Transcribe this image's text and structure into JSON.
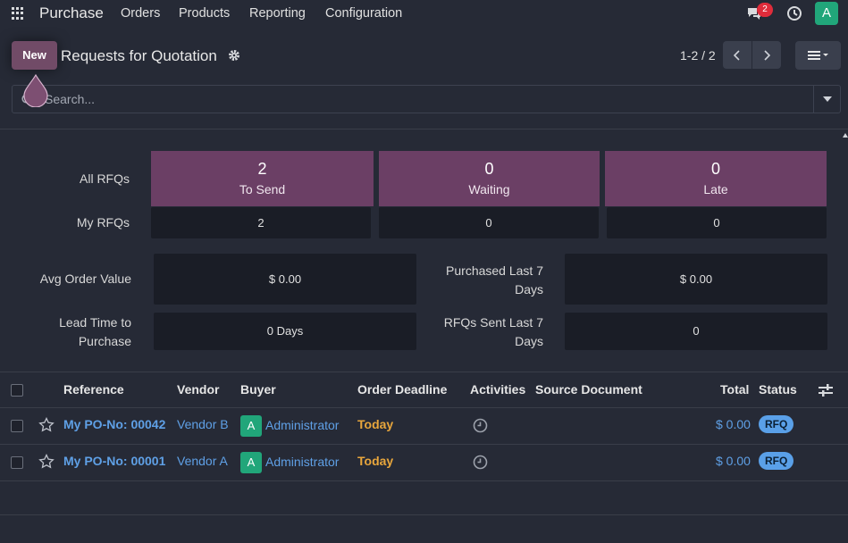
{
  "navbar": {
    "brand": "Purchase",
    "menu": [
      "Orders",
      "Products",
      "Reporting",
      "Configuration"
    ],
    "chat_badge": "2",
    "avatar_letter": "A"
  },
  "control": {
    "new_label": "New",
    "title": "Requests for Quotation",
    "pager": "1-2 / 2",
    "search_placeholder": "Search..."
  },
  "dashboard": {
    "row1_label": "All RFQs",
    "row2_label": "My RFQs",
    "tiles": [
      {
        "num": "2",
        "label": "To Send"
      },
      {
        "num": "0",
        "label": "Waiting"
      },
      {
        "num": "0",
        "label": "Late"
      }
    ],
    "my_values": [
      "2",
      "0",
      "0"
    ],
    "metrics": [
      {
        "label_l1": "Avg Order Value",
        "label_l2": "",
        "value": "$ 0.00"
      },
      {
        "label_l1": "Purchased Last 7",
        "label_l2": "Days",
        "value": "$ 0.00"
      },
      {
        "label_l1": "Lead Time to",
        "label_l2": "Purchase",
        "value": "0 Days"
      },
      {
        "label_l1": "RFQs Sent Last 7",
        "label_l2": "Days",
        "value": "0"
      }
    ]
  },
  "table": {
    "columns": [
      "Reference",
      "Vendor",
      "Buyer",
      "Order Deadline",
      "Activities",
      "Source Document",
      "Total",
      "Status"
    ],
    "rows": [
      {
        "reference": "My PO-No: 00042",
        "vendor": "Vendor B",
        "buyer_initial": "A",
        "buyer": "Administrator",
        "deadline": "Today",
        "source": "",
        "total": "$ 0.00",
        "status": "RFQ"
      },
      {
        "reference": "My PO-No: 00001",
        "vendor": "Vendor A",
        "buyer_initial": "A",
        "buyer": "Administrator",
        "deadline": "Today",
        "source": "",
        "total": "$ 0.00",
        "status": "RFQ"
      }
    ]
  },
  "colors": {
    "accent": "#714b67",
    "tile": "#6b3f65",
    "link": "#5fa0e6",
    "deadline": "#e8a63c",
    "avatar": "#21a67a"
  },
  "icons": [
    "apps-grid-icon",
    "chat-icon",
    "clock-icon",
    "gear-icon",
    "chevron-left-icon",
    "chevron-right-icon",
    "list-view-icon",
    "search-icon",
    "caret-down-icon",
    "star-icon",
    "activity-clock-icon",
    "column-settings-icon"
  ]
}
